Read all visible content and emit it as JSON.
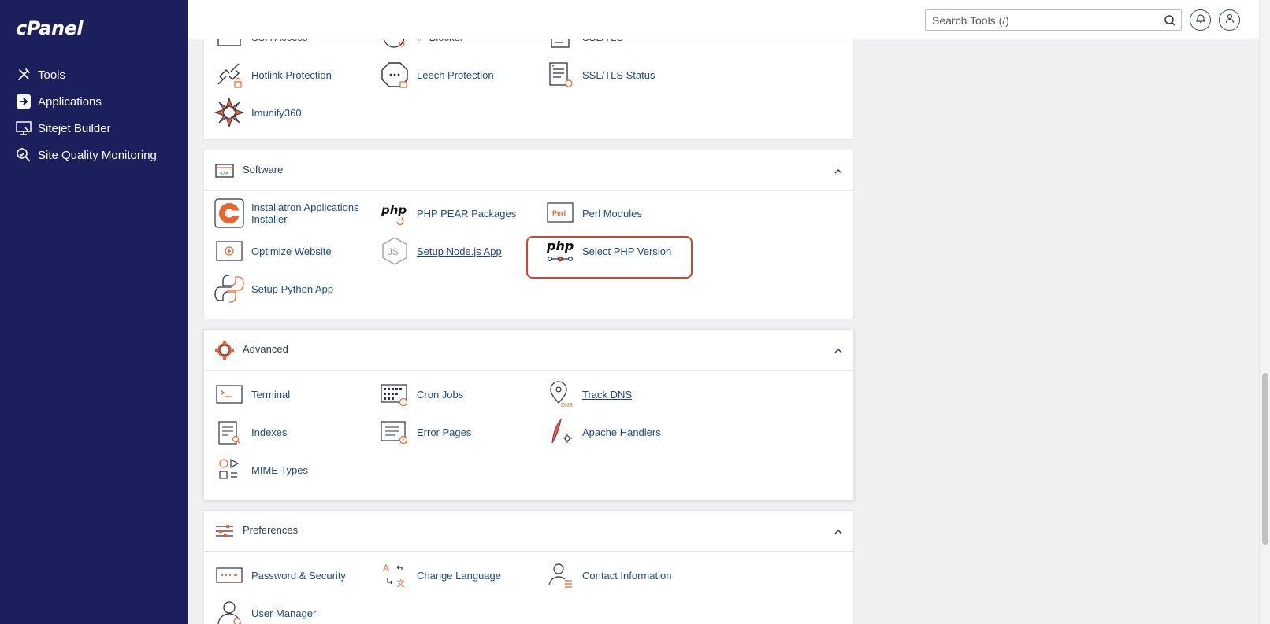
{
  "sidebar": {
    "logo": "cPanel",
    "items": [
      {
        "label": "Tools",
        "icon": "tools-icon"
      },
      {
        "label": "Applications",
        "icon": "applications-icon"
      },
      {
        "label": "Sitejet Builder",
        "icon": "sitejet-icon"
      },
      {
        "label": "Site Quality Monitoring",
        "icon": "site-quality-icon"
      }
    ]
  },
  "header": {
    "search_placeholder": "Search Tools (/)",
    "search_icon": "search-icon",
    "notifications_icon": "bell-icon",
    "user_icon": "user-icon"
  },
  "security": {
    "partial_row": [
      "SSH Access",
      "IP Blocker",
      "SSL/TLS"
    ],
    "tools": [
      "Hotlink Protection",
      "Leech Protection",
      "SSL/TLS Status",
      "Imunify360"
    ]
  },
  "software": {
    "title": "Software",
    "tools": [
      "Installatron Applications Installer",
      "PHP PEAR Packages",
      "Perl Modules",
      "Optimize Website",
      "Setup Node.js App",
      "Select PHP Version",
      "Setup Python App"
    ]
  },
  "advanced": {
    "title": "Advanced",
    "tools": [
      "Terminal",
      "Cron Jobs",
      "Track DNS",
      "Indexes",
      "Error Pages",
      "Apache Handlers",
      "MIME Types"
    ]
  },
  "preferences": {
    "title": "Preferences",
    "tools": [
      "Password & Security",
      "Change Language",
      "Contact Information",
      "User Manager"
    ]
  },
  "colors": {
    "sidebar_bg": "#1b1f5c",
    "accent_orange": "#e8652f",
    "highlight_red": "#d2432e",
    "link_blue": "#1f4a7c"
  }
}
